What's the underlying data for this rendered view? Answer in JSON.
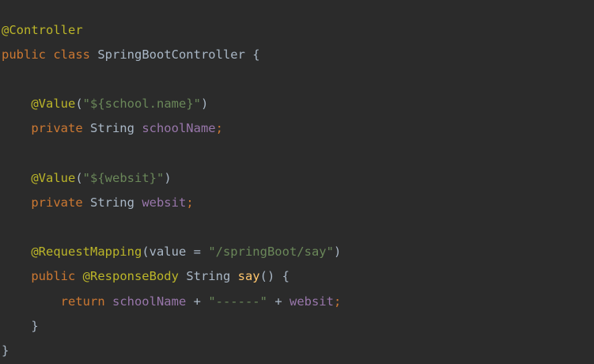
{
  "editor": {
    "background": "#2b2b2b",
    "token_colors": {
      "annotation": "#bbb529",
      "keyword": "#cc7832",
      "string": "#6a8759",
      "field": "#9876aa",
      "method": "#ffc66d",
      "plain": "#a9b7c6"
    },
    "lines": [
      [
        {
          "t": "@Controller",
          "k": "anno"
        }
      ],
      [
        {
          "t": "public ",
          "k": "kw"
        },
        {
          "t": "class ",
          "k": "kw"
        },
        {
          "t": "SpringBootController {",
          "k": "plain"
        }
      ],
      [],
      [
        {
          "t": "    ",
          "k": "plain"
        },
        {
          "t": "@Value",
          "k": "anno"
        },
        {
          "t": "(",
          "k": "plain"
        },
        {
          "t": "\"${school.name}\"",
          "k": "str"
        },
        {
          "t": ")",
          "k": "plain"
        }
      ],
      [
        {
          "t": "    ",
          "k": "plain"
        },
        {
          "t": "private ",
          "k": "kw"
        },
        {
          "t": "String ",
          "k": "plain"
        },
        {
          "t": "schoolName",
          "k": "field"
        },
        {
          "t": ";",
          "k": "kw"
        }
      ],
      [],
      [
        {
          "t": "    ",
          "k": "plain"
        },
        {
          "t": "@Value",
          "k": "anno"
        },
        {
          "t": "(",
          "k": "plain"
        },
        {
          "t": "\"${websit}\"",
          "k": "str"
        },
        {
          "t": ")",
          "k": "plain"
        }
      ],
      [
        {
          "t": "    ",
          "k": "plain"
        },
        {
          "t": "private ",
          "k": "kw"
        },
        {
          "t": "String ",
          "k": "plain"
        },
        {
          "t": "websit",
          "k": "field"
        },
        {
          "t": ";",
          "k": "kw"
        }
      ],
      [],
      [
        {
          "t": "    ",
          "k": "plain"
        },
        {
          "t": "@RequestMapping",
          "k": "anno"
        },
        {
          "t": "(value = ",
          "k": "plain"
        },
        {
          "t": "\"/springBoot/say\"",
          "k": "str"
        },
        {
          "t": ")",
          "k": "plain"
        }
      ],
      [
        {
          "t": "    ",
          "k": "plain"
        },
        {
          "t": "public ",
          "k": "kw"
        },
        {
          "t": "@ResponseBody ",
          "k": "anno"
        },
        {
          "t": "String ",
          "k": "plain"
        },
        {
          "t": "say",
          "k": "method"
        },
        {
          "t": "() {",
          "k": "plain"
        }
      ],
      [
        {
          "t": "        ",
          "k": "plain"
        },
        {
          "t": "return ",
          "k": "kw"
        },
        {
          "t": "schoolName ",
          "k": "field"
        },
        {
          "t": "+ ",
          "k": "plain"
        },
        {
          "t": "\"------\" ",
          "k": "str"
        },
        {
          "t": "+ ",
          "k": "plain"
        },
        {
          "t": "websit",
          "k": "field"
        },
        {
          "t": ";",
          "k": "kw"
        }
      ],
      [
        {
          "t": "    }",
          "k": "plain"
        }
      ],
      [
        {
          "t": "}",
          "k": "plain"
        }
      ]
    ]
  }
}
